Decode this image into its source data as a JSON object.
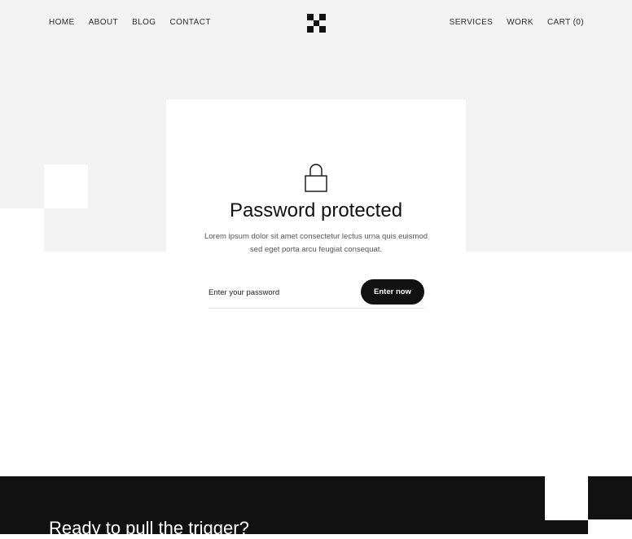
{
  "nav": {
    "left": [
      "HOME",
      "ABOUT",
      "BLOG",
      "CONTACT"
    ],
    "right": [
      "SERVICES",
      "WORK",
      "CART (0)"
    ]
  },
  "logo": {
    "icon": "checker-logo-icon"
  },
  "protect": {
    "icon": "lock-icon",
    "title": "Password protected",
    "description": "Lorem ipsum dolor sit amet consectetur lectus urna quis euismod sed eget porta arcu feugiat consequat.",
    "input_placeholder": "Enter your password",
    "input_value": "",
    "button_label": "Enter now"
  },
  "footer": {
    "title": "Ready to pull the trigger?"
  },
  "colors": {
    "background_gray": "#f3f3f3",
    "dark": "#111111",
    "white": "#ffffff"
  }
}
